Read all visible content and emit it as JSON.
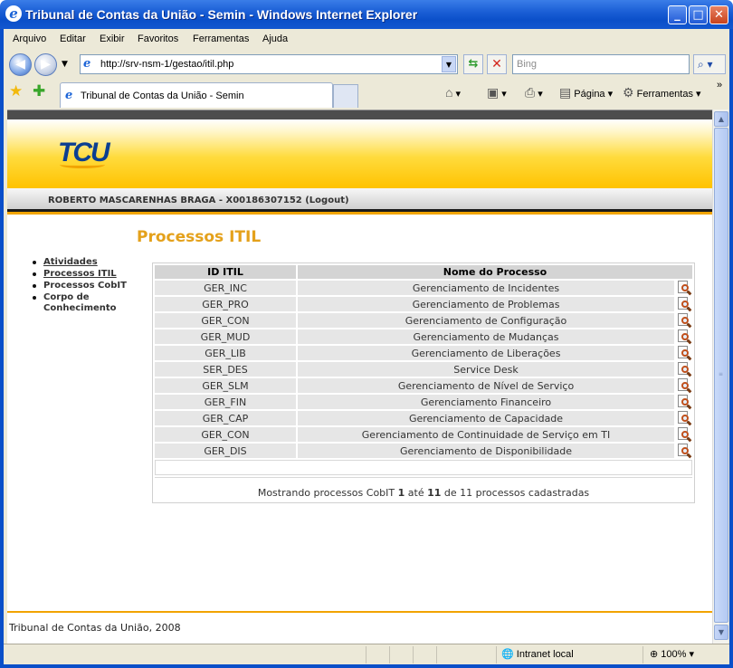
{
  "window": {
    "title": "Tribunal de Contas da União - Semin - Windows Internet Explorer",
    "minimize": "_",
    "maximize": "□",
    "close": "✕"
  },
  "menu": [
    "Arquivo",
    "Editar",
    "Exibir",
    "Favoritos",
    "Ferramentas",
    "Ajuda"
  ],
  "address": {
    "url": "http://srv-nsm-1/gestao/itil.php"
  },
  "search": {
    "placeholder": "Bing"
  },
  "tab": {
    "title": "Tribunal de Contas da União - Semin"
  },
  "commands": {
    "page": "Página",
    "tools": "Ferramentas"
  },
  "header": {
    "logo": "TCU"
  },
  "user": {
    "name": "ROBERTO MASCARENHAS BRAGA - X00186307152",
    "logout": "(Logout)"
  },
  "page_title": "Processos ITIL",
  "nav": [
    {
      "label": "Atividades"
    },
    {
      "label": "Processos ITIL"
    },
    {
      "label": "Processos CobIT"
    },
    {
      "label": "Corpo de Conhecimento"
    }
  ],
  "table": {
    "headers": [
      "ID ITIL",
      "Nome do Processo"
    ],
    "rows": [
      {
        "id": "GER_INC",
        "name": "Gerenciamento de Incidentes"
      },
      {
        "id": "GER_PRO",
        "name": "Gerenciamento de Problemas"
      },
      {
        "id": "GER_CON",
        "name": "Gerenciamento de Configuração"
      },
      {
        "id": "GER_MUD",
        "name": "Gerenciamento de Mudanças"
      },
      {
        "id": "GER_LIB",
        "name": "Gerenciamento de Liberações"
      },
      {
        "id": "SER_DES",
        "name": "Service Desk"
      },
      {
        "id": "GER_SLM",
        "name": "Gerenciamento de Nível de Serviço"
      },
      {
        "id": "GER_FIN",
        "name": "Gerenciamento Financeiro"
      },
      {
        "id": "GER_CAP",
        "name": "Gerenciamento de Capacidade"
      },
      {
        "id": "GER_CON",
        "name": "Gerenciamento de Continuidade de Serviço em TI"
      },
      {
        "id": "GER_DIS",
        "name": "Gerenciamento de Disponibilidade"
      }
    ],
    "summary": {
      "prefix": "Mostrando processos CobIT",
      "from": "1",
      "mid": "até",
      "to": "11",
      "suffix": "de 11 processos cadastradas"
    }
  },
  "footer": "Tribunal de Contas da União, 2008",
  "status": {
    "zone": "Intranet local",
    "zoom": "100%"
  }
}
